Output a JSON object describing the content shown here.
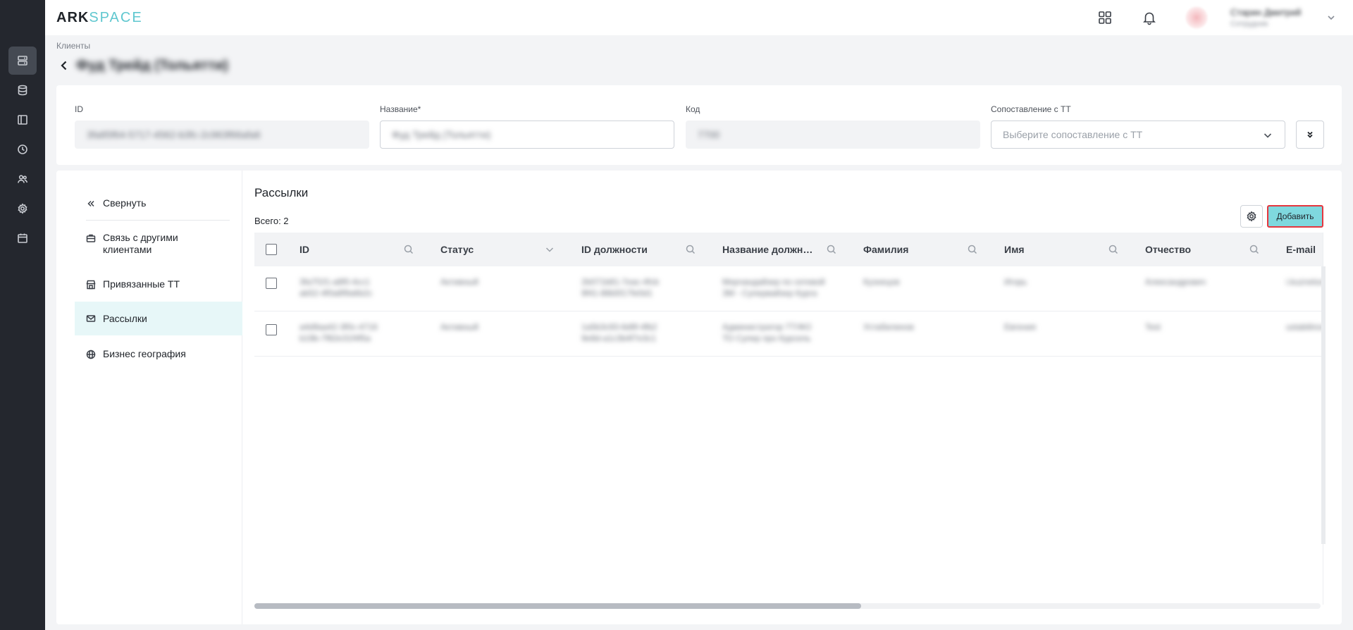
{
  "app": {
    "logo_part1": "ARK",
    "logo_part2": "SPACE"
  },
  "nav": {
    "icons": [
      "documents-icon",
      "database-icon",
      "book-icon",
      "clock-icon",
      "users-icon",
      "gear-icon",
      "calendar-icon"
    ]
  },
  "header": {
    "user_name": "Старин Дмитрий",
    "user_role": "Сотрудник"
  },
  "breadcrumb": "Клиенты",
  "page_title": "Фуд Трейд (Тольятти)",
  "form": {
    "id_label": "ID",
    "id_value": "3fa85f64-5717-4562-b3fc-2c963f66afa6",
    "name_label": "Название*",
    "name_value": "Фуд Трейд (Тольятти)",
    "code_label": "Код",
    "code_value": "7700",
    "tt_label": "Сопоставление с ТТ",
    "tt_placeholder": "Выберите сопоставление с ТТ"
  },
  "side": {
    "collapse": "Свернуть",
    "items": [
      {
        "label": "Связь с другими клиентами"
      },
      {
        "label": "Привязанные ТТ"
      },
      {
        "label": "Рассылки"
      },
      {
        "label": "Бизнес география"
      }
    ]
  },
  "section": {
    "title": "Рассылки",
    "total": "Всего: 2",
    "add_label": "Добавить"
  },
  "table": {
    "columns": [
      "ID",
      "Статус",
      "ID должности",
      "Название должн…",
      "Фамилия",
      "Имя",
      "Отчество",
      "E-mail"
    ],
    "rows": [
      {
        "id": [
          "3fa7f1f1-a8f0-4cc1",
          "ab52-4f0a8f9a6b2c"
        ],
        "status": "Активный",
        "pos_id": [
          "2b071b81-7eac-4fcb",
          "9f41-88b5f17fe0d1"
        ],
        "pos_name": [
          "Мерчандайзер по сетевой",
          "ЗМ - Супервайзер Курга"
        ],
        "last": "Кузнецов",
        "first": "Игорь",
        "middle": "Александрович",
        "email": "i.kuznetsov@"
      },
      {
        "id": [
          "a4d9aa42-3f0c-4716",
          "b19b-7f82e31f4f5a"
        ],
        "status": "Активный",
        "pos_id": [
          "1a5b3c93-6d9f-4fb2",
          "9e8d-a1c3b4f7e3c1"
        ],
        "pos_name": [
          "Администратор ТТ/ФО",
          "ТО Супер про Курсель"
        ],
        "last": "Устабилинов",
        "first": "Евгения",
        "middle": "Test",
        "email": "ustabilinov@"
      }
    ]
  }
}
